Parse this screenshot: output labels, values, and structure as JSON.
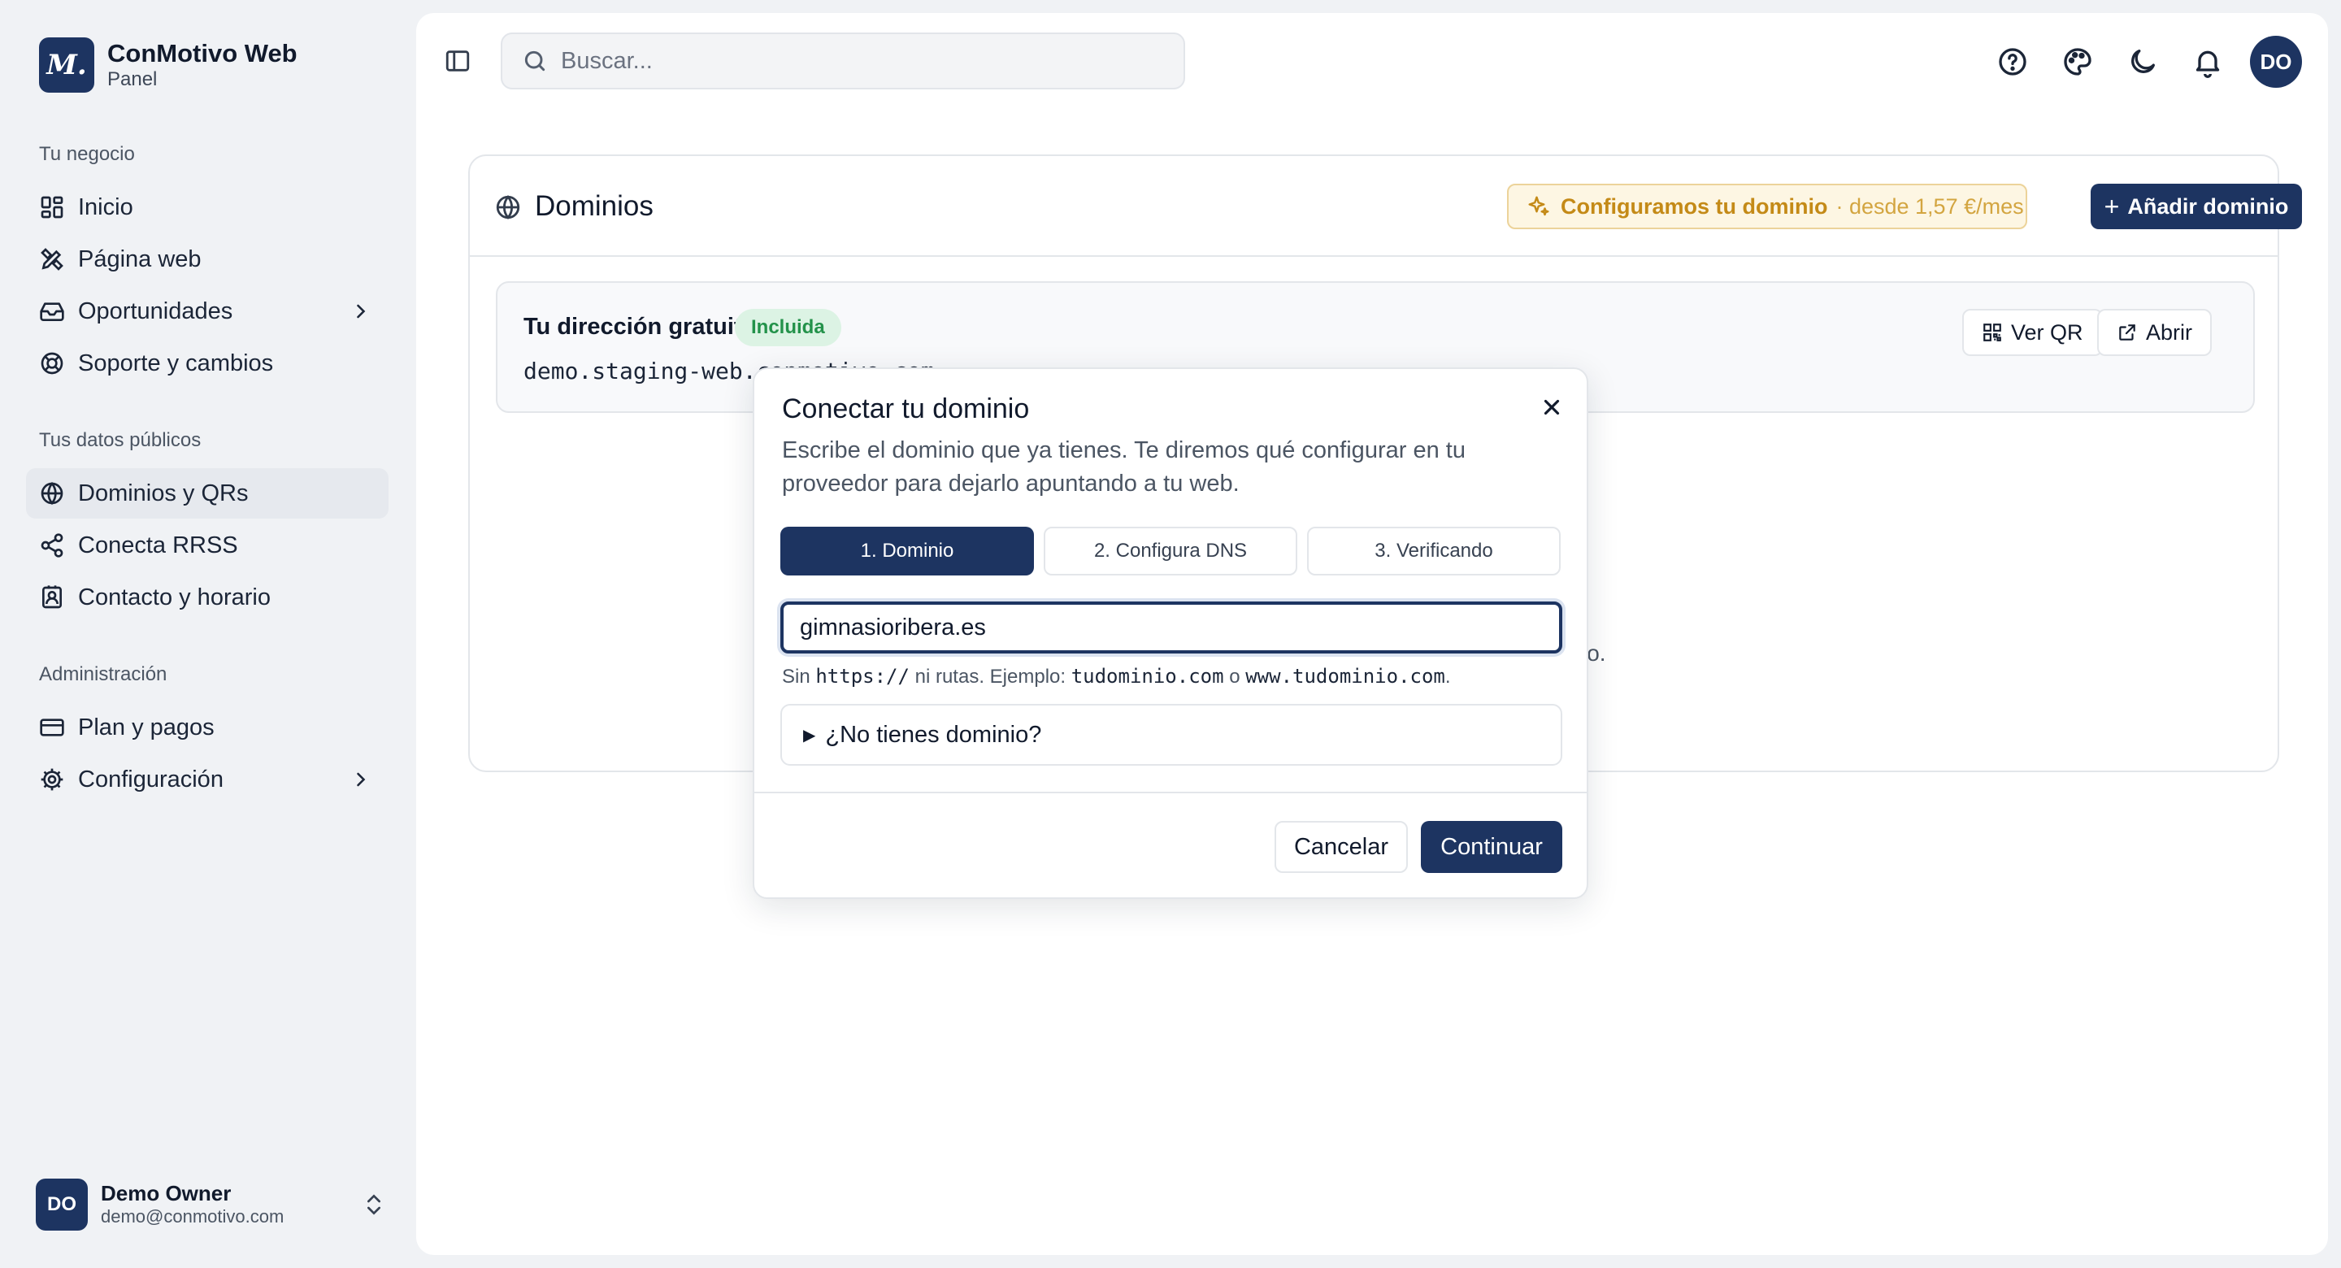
{
  "brand": {
    "logo": "M.",
    "name": "ConMotivo Web",
    "subtitle": "Panel"
  },
  "sidebar": {
    "groups": [
      {
        "title": "Tu negocio",
        "items": [
          {
            "label": "Inicio",
            "icon": "grid-icon"
          },
          {
            "label": "Página web",
            "icon": "design-icon"
          },
          {
            "label": "Oportunidades",
            "icon": "inbox-icon",
            "has_submenu": true
          },
          {
            "label": "Soporte y cambios",
            "icon": "lifebuoy-icon"
          }
        ]
      },
      {
        "title": "Tus datos públicos",
        "items": [
          {
            "label": "Dominios y QRs",
            "icon": "globe-icon",
            "active": true
          },
          {
            "label": "Conecta RRSS",
            "icon": "share-icon"
          },
          {
            "label": "Contacto y horario",
            "icon": "contact-icon"
          }
        ]
      },
      {
        "title": "Administración",
        "items": [
          {
            "label": "Plan y pagos",
            "icon": "credit-card-icon"
          },
          {
            "label": "Configuración",
            "icon": "gear-icon",
            "has_submenu": true
          }
        ]
      }
    ]
  },
  "user": {
    "initials": "DO",
    "name": "Demo Owner",
    "email": "demo@conmotivo.com"
  },
  "topbar": {
    "search_placeholder": "Buscar...",
    "avatar_initials": "DO",
    "icons": [
      "help-icon",
      "palette-icon",
      "moon-icon",
      "bell-icon"
    ]
  },
  "domains_card": {
    "title": "Dominios",
    "promo_strong": "Configuramos tu dominio",
    "promo_light": "· desde 1,57 €/mes",
    "add_button": "Añadir dominio",
    "free_address": {
      "title": "Tu dirección gratuita",
      "badge": "Incluida",
      "url": "demo.staging-web.conmotivo.com",
      "qr_button": "Ver QR",
      "open_button": "Abrir"
    },
    "hint_tail": "io."
  },
  "modal": {
    "title": "Conectar tu dominio",
    "description": "Escribe el dominio que ya tienes. Te diremos qué configurar en tu proveedor para dejarlo apuntando a tu web.",
    "steps": [
      "1. Dominio",
      "2. Configura DNS",
      "3. Verificando"
    ],
    "active_step": 0,
    "domain_value": "gimnasioribera.es",
    "hint": {
      "t1": "Sin ",
      "c1": "https://",
      "t2": " ni rutas. Ejemplo: ",
      "c2": "tudominio.com",
      "t3": " o ",
      "c3": "www.tudominio.com",
      "t4": "."
    },
    "no_domain_summary": "¿No tienes dominio?",
    "cancel": "Cancelar",
    "continue": "Continuar"
  },
  "colors": {
    "brand": "#1d3461",
    "accent_gold": "#c48a17",
    "success": "#23924a"
  }
}
